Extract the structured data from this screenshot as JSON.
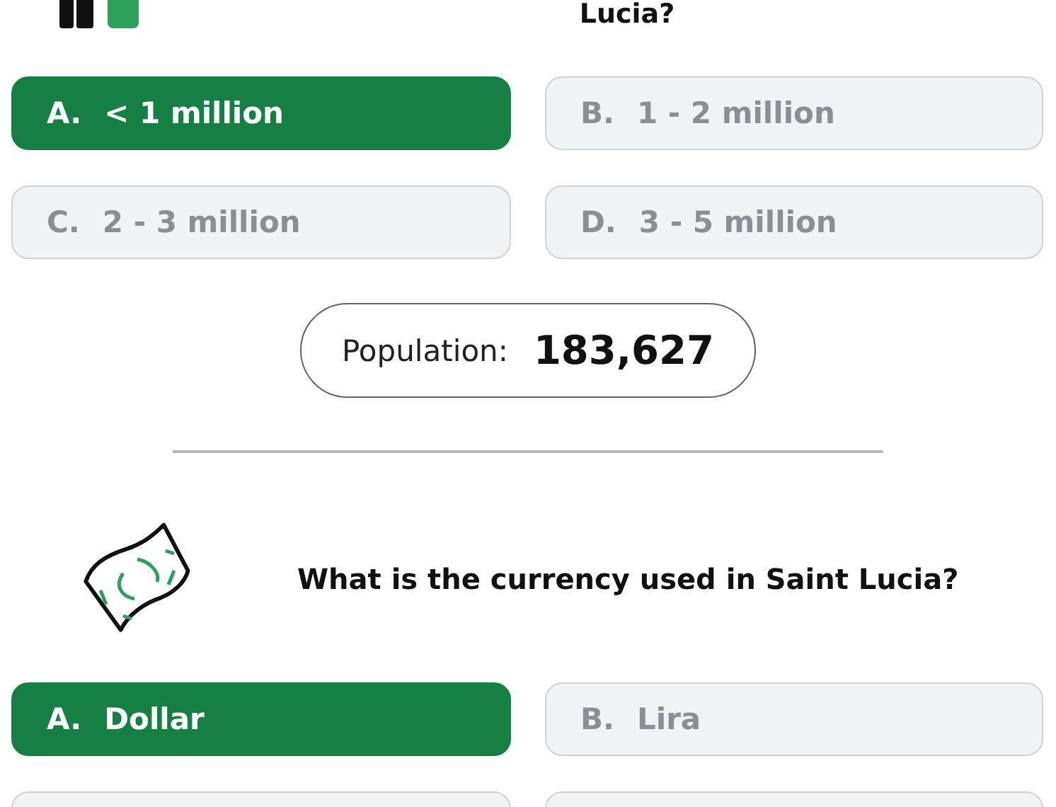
{
  "partial_question": {
    "text": "Lucia?"
  },
  "questions": [
    {
      "kind": "population",
      "options": [
        {
          "letter": "A.",
          "text": "< 1 million",
          "selected": true
        },
        {
          "letter": "B.",
          "text": "1 - 2 million",
          "selected": false
        },
        {
          "letter": "C.",
          "text": "2 - 3 million",
          "selected": false
        },
        {
          "letter": "D.",
          "text": "3 - 5 million",
          "selected": false
        }
      ],
      "answer": {
        "label": "Population:",
        "value": "183,627"
      }
    },
    {
      "kind": "currency",
      "question": "What is the currency used in Saint Lucia?",
      "options": [
        {
          "letter": "A.",
          "text": "Dollar",
          "selected": true
        },
        {
          "letter": "B.",
          "text": "Lira",
          "selected": false
        },
        {
          "selected": false
        },
        {
          "selected": false
        }
      ]
    }
  ]
}
